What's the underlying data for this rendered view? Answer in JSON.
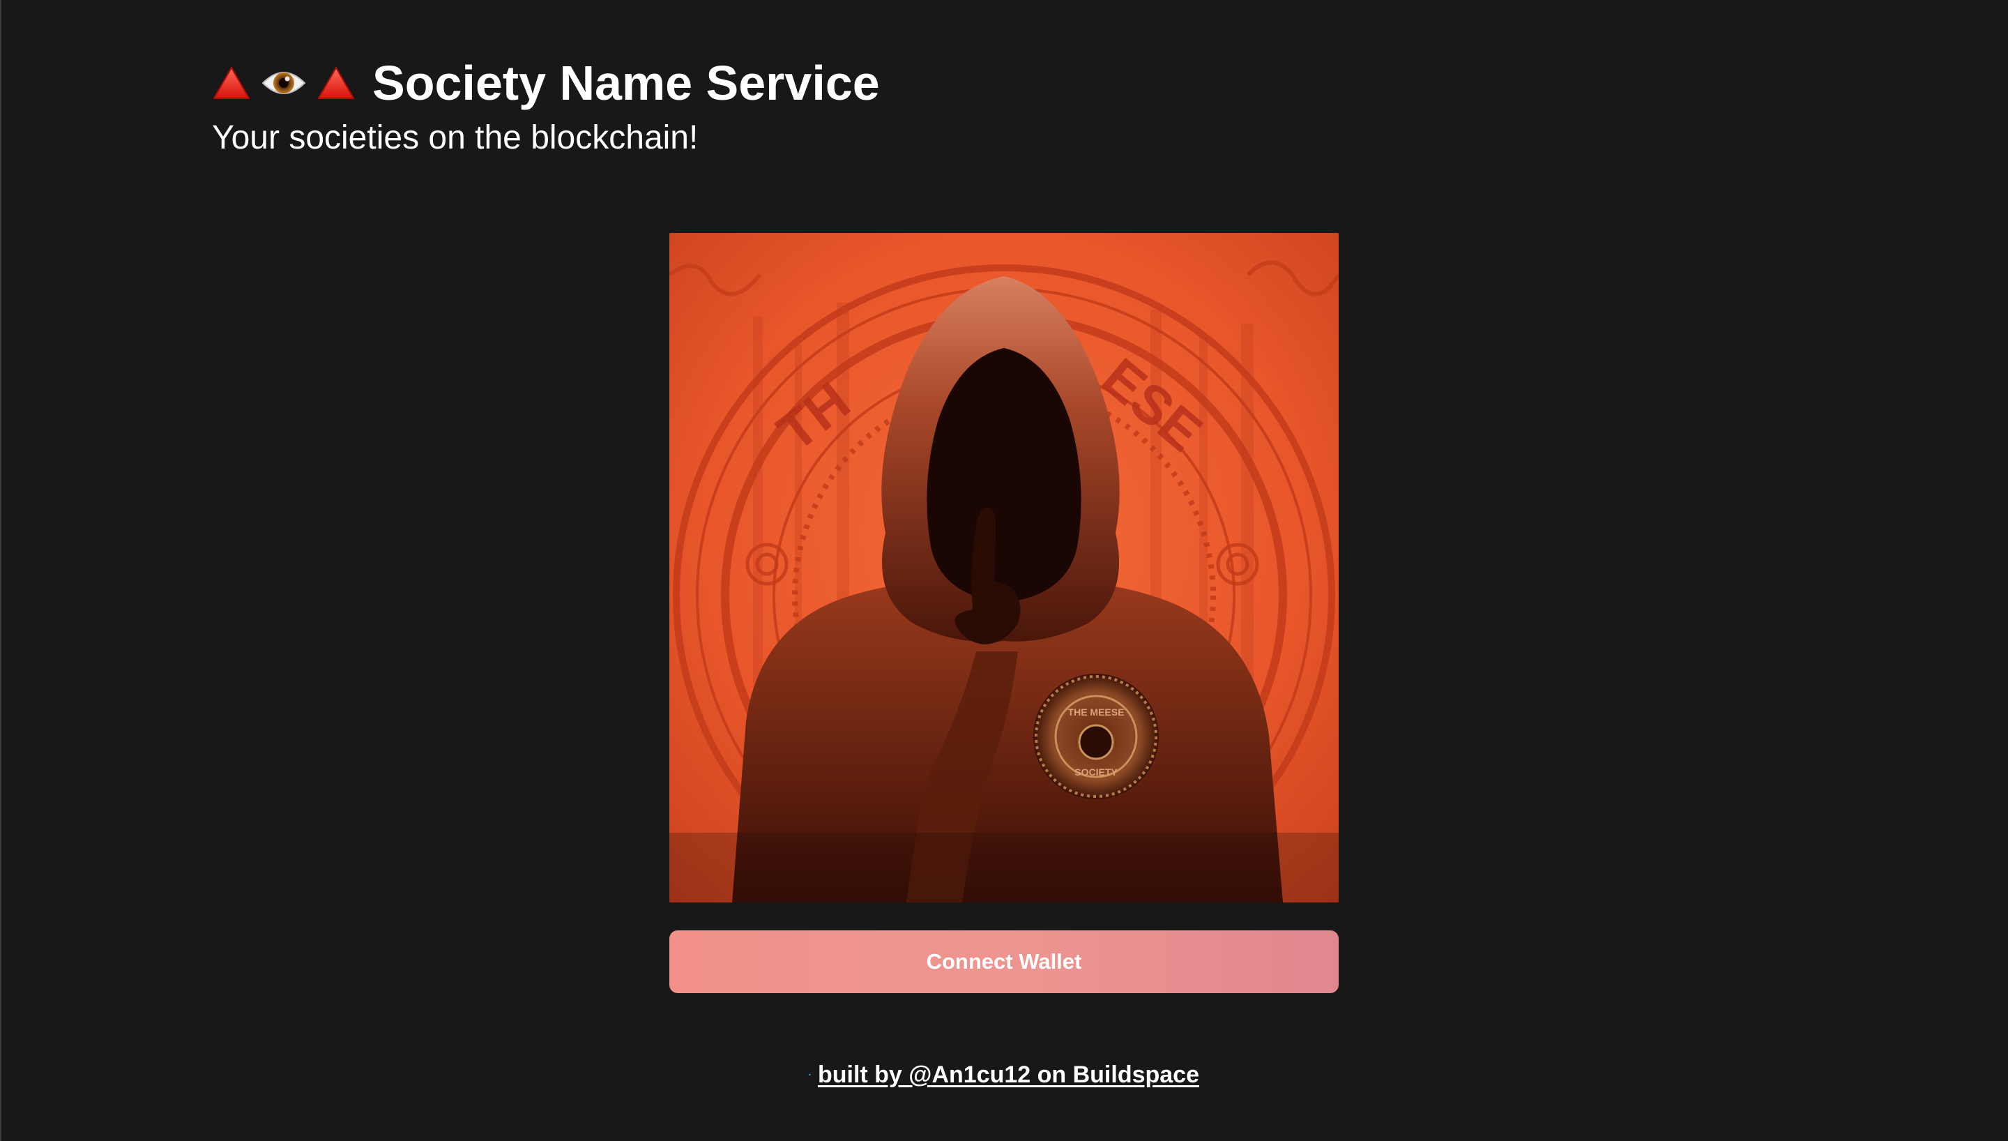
{
  "header": {
    "icons": [
      "red-triangle-icon",
      "eye-icon",
      "red-triangle-icon"
    ],
    "title": "Society Name Service",
    "subtitle": "Your societies on the blockchain!"
  },
  "hero": {
    "image": "hooded-figure-illustration",
    "seal_text": "THE MEESE SOCIETY",
    "palette": {
      "bg": "#e8562a",
      "deep": "#c33a1a",
      "shadow": "#2a0a04",
      "hoodie": "#8a2e14"
    }
  },
  "actions": {
    "connect_label": "Connect Wallet",
    "connect_color": "#ef938c"
  },
  "footer": {
    "icon": "twitter-icon",
    "link_text": "built by @An1cu12 on Buildspace",
    "icon_color": "#1da1f2"
  }
}
